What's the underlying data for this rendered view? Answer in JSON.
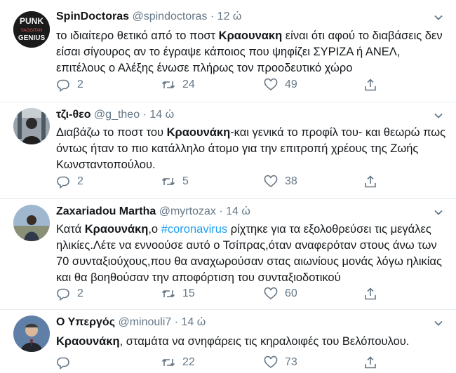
{
  "tweets": [
    {
      "name": "SpinDoctoras",
      "handle": "@spindoctoras",
      "sep": "·",
      "time": "12 ώ",
      "avatar_label_1": "PUNK",
      "avatar_label_2": "SAGGITAN",
      "avatar_label_3": "GENIUS",
      "text_pre": "το ιδιαίτερο θετικό από το ποστ ",
      "text_bold": "Κραουνακη",
      "text_post": " είναι ότι αφού το διαβάσεις δεν είσαι σίγουρος αν το έγραψε κάποιος που ψηφίζει ΣΥΡΙΖΑ ή ΑΝΕΛ, επιτέλους ο Αλέξης ένωσε πλήρως τον προοδευτικό χώρο",
      "replies": "2",
      "retweets": "24",
      "likes": "49"
    },
    {
      "name": "τζι-θεο",
      "handle": "@g_theo",
      "sep": "·",
      "time": "14 ώ",
      "text_pre": "Διαβάζω το ποστ του ",
      "text_bold": "Κραουνάκη",
      "text_post": "-και γενικά το προφίλ του- και θεωρώ πως όντως ήταν το πιο κατάλληλο άτομο για την επιτροπή χρέους της Ζωής Κωνσταντοπούλου.",
      "replies": "2",
      "retweets": "5",
      "likes": "38"
    },
    {
      "name": "Zaxariadou Martha",
      "handle": "@myrtozax",
      "sep": "·",
      "time": "14 ώ",
      "text_pre": "Κατά ",
      "text_bold": "Κραουνάκη",
      "text_mid": ",ο ",
      "text_tag": "#coronavirus",
      "text_post": " ρίχτηκε για τα εξολοθρεύσει τις μεγάλες ηλικίες.Λέτε να εννοούσε αυτό ο Τσίπρας,όταν αναφερόταν στους άνω των 70 συνταξιούχους,που θα αναχωρούσαν στας αιωνίους μονάς λόγω ηλικίας και θα βοηθούσαν την αποφόρτιση του συνταξιοδοτικού",
      "replies": "2",
      "retweets": "15",
      "likes": "60"
    },
    {
      "name": "Ο Υπεργός",
      "handle": "@minouli7",
      "sep": "·",
      "time": "14 ώ",
      "text_bold": "Κραουνάκη",
      "text_post": ", σταμάτα να σνηφάρεις τις κηραλοιφές του Βελόπουλου.",
      "retweets": "22",
      "likes": "73"
    }
  ],
  "colors": {
    "accent": "#1da1f2",
    "muted": "#657786",
    "text": "#14171a",
    "divider": "#e6ecf0"
  },
  "icons": {
    "reply": "reply-icon",
    "retweet": "retweet-icon",
    "like": "heart-icon",
    "share": "share-icon",
    "menu": "chevron-down-icon"
  }
}
